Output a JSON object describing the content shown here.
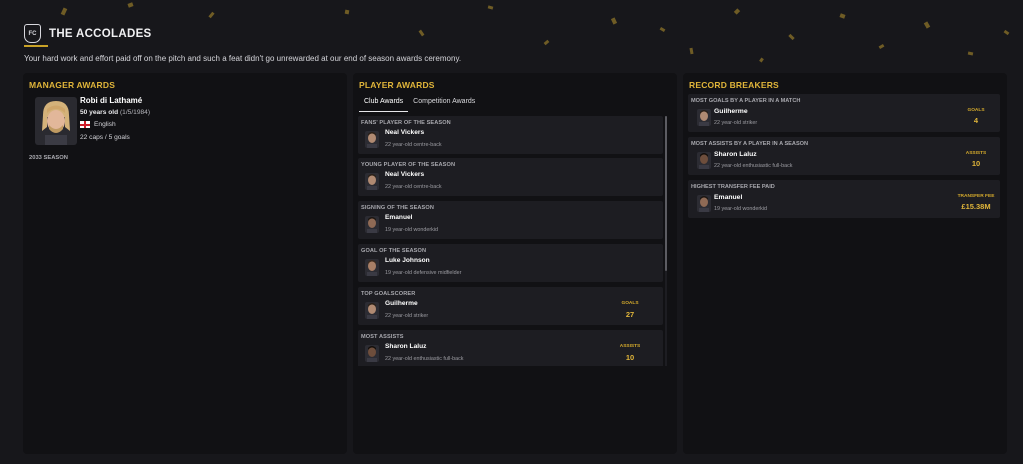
{
  "header": {
    "title": "THE ACCOLADES",
    "intro": "Your hard work and effort paid off on the pitch and such a feat didn't go unrewarded at our end of season awards ceremony."
  },
  "colors": {
    "accent": "#e0b53a",
    "background": "#17171b",
    "panel": "#111114",
    "card": "#1d1d22"
  },
  "manager_awards": {
    "title": "MANAGER AWARDS",
    "name": "Robi di Lathamé",
    "age_text": "50 years old",
    "dob": "(1/5/1984)",
    "nationality": "English",
    "caps": "22 caps / 5 goals",
    "season": "2033 SEASON"
  },
  "player_awards": {
    "title": "PLAYER AWARDS",
    "tabs": [
      {
        "label": "Club Awards",
        "active": true
      },
      {
        "label": "Competition Awards",
        "active": false
      }
    ],
    "awards": [
      {
        "category": "FANS' PLAYER OF THE SEASON",
        "name": "Neal Vickers",
        "desc": "22 year-old centre-back",
        "stat_label": "",
        "stat_value": ""
      },
      {
        "category": "YOUNG PLAYER OF THE SEASON",
        "name": "Neal Vickers",
        "desc": "22 year-old centre-back",
        "stat_label": "",
        "stat_value": ""
      },
      {
        "category": "SIGNING OF THE SEASON",
        "name": "Emanuel",
        "desc": "19 year-old wonderkid",
        "stat_label": "",
        "stat_value": ""
      },
      {
        "category": "GOAL OF THE SEASON",
        "name": "Luke Johnson",
        "desc": "19 year-old defensive midfielder",
        "stat_label": "",
        "stat_value": ""
      },
      {
        "category": "TOP GOALSCORER",
        "name": "Guilherme",
        "desc": "22 year-old striker",
        "stat_label": "GOALS",
        "stat_value": "27"
      },
      {
        "category": "MOST ASSISTS",
        "name": "Sharon Laluz",
        "desc": "22 year-old enthusiastic full-back",
        "stat_label": "ASSISTS",
        "stat_value": "10"
      }
    ]
  },
  "record_breakers": {
    "title": "RECORD BREAKERS",
    "records": [
      {
        "category": "MOST GOALS BY A PLAYER IN A MATCH",
        "name": "Guilherme",
        "desc": "22 year-old striker",
        "stat_label": "GOALS",
        "stat_value": "4"
      },
      {
        "category": "MOST ASSISTS BY A PLAYER IN A SEASON",
        "name": "Sharon Laluz",
        "desc": "22 year-old enthusiastic full-back",
        "stat_label": "ASSISTS",
        "stat_value": "10"
      },
      {
        "category": "HIGHEST TRANSFER FEE PAID",
        "name": "Emanuel",
        "desc": "19 year-old wonderkid",
        "stat_label": "TRANSFER FEE",
        "stat_value": "£15.38M"
      }
    ]
  }
}
